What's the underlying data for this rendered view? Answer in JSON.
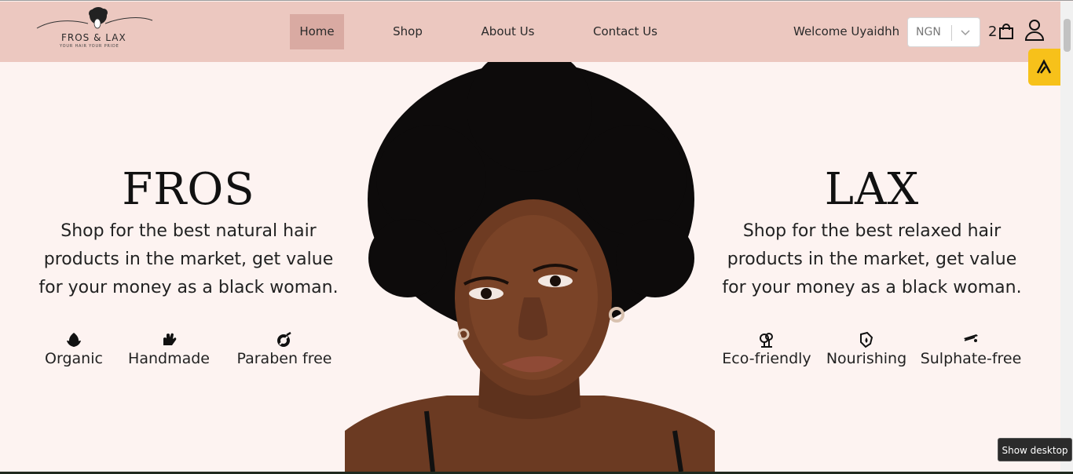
{
  "nav": {
    "logo_text": "FROS & LAX",
    "logo_tagline": "YOUR HAIR YOUR PRIDE",
    "links": [
      {
        "label": "Home"
      },
      {
        "label": "Shop"
      },
      {
        "label": "About Us"
      },
      {
        "label": "Contact Us"
      }
    ],
    "welcome": "Welcome Uyaidhh",
    "currency": "NGN",
    "cart_count": "2"
  },
  "hero": {
    "left": {
      "title": "FROS",
      "desc_lines": [
        "Shop for the best natural hair",
        "products in the market, get value",
        "for your money as a black woman."
      ],
      "features": [
        {
          "label": "Organic",
          "icon": "leaf-icon"
        },
        {
          "label": "Handmade",
          "icon": "hand-icon"
        },
        {
          "label": "Paraben free",
          "icon": "no-chemical-icon"
        }
      ]
    },
    "right": {
      "title": "LAX",
      "desc_lines": [
        "Shop for the best relaxed hair",
        "products in the market, get value",
        "for your money as a black woman."
      ],
      "features": [
        {
          "label": "Eco-friendly",
          "icon": "tree-icon"
        },
        {
          "label": "Nourishing",
          "icon": "droplet-hand-icon"
        },
        {
          "label": "Sulphate-free",
          "icon": "flat-iron-icon"
        }
      ]
    }
  },
  "tooltip": "Show desktop",
  "colors": {
    "nav_bg": "#ecc8c0",
    "nav_active": "#d9aaa2",
    "page_bg": "#fdf3f1",
    "accent_badge": "#f7c11a"
  }
}
